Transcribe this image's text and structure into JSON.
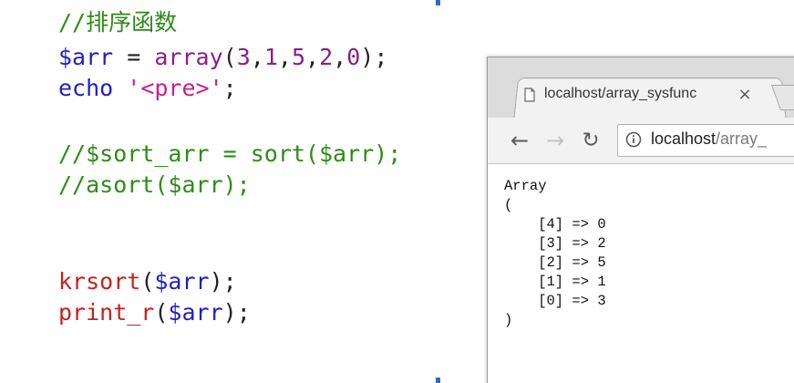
{
  "editor": {
    "lines": [
      {
        "tokens": [
          {
            "t": "//排序函数",
            "c": "tok-comment"
          }
        ]
      },
      {
        "tokens": [
          {
            "t": "$arr",
            "c": "tok-var"
          },
          {
            "t": " = ",
            "c": "tok-plain"
          },
          {
            "t": "array",
            "c": "tok-fn"
          },
          {
            "t": "(",
            "c": "tok-plain"
          },
          {
            "t": "3",
            "c": "tok-num"
          },
          {
            "t": ",",
            "c": "tok-plain"
          },
          {
            "t": "1",
            "c": "tok-num"
          },
          {
            "t": ",",
            "c": "tok-plain"
          },
          {
            "t": "5",
            "c": "tok-num"
          },
          {
            "t": ",",
            "c": "tok-plain"
          },
          {
            "t": "2",
            "c": "tok-num"
          },
          {
            "t": ",",
            "c": "tok-plain"
          },
          {
            "t": "0",
            "c": "tok-num"
          },
          {
            "t": ");",
            "c": "tok-plain"
          }
        ]
      },
      {
        "tokens": [
          {
            "t": "echo",
            "c": "tok-var"
          },
          {
            "t": " ",
            "c": "tok-plain"
          },
          {
            "t": "'<pre>'",
            "c": "tok-str"
          },
          {
            "t": ";",
            "c": "tok-plain"
          }
        ]
      },
      {
        "tokens": []
      },
      {
        "tokens": [
          {
            "t": "//$sort_arr = sort($arr);",
            "c": "tok-comment"
          }
        ]
      },
      {
        "tokens": [
          {
            "t": "//asort($arr);",
            "c": "tok-comment"
          }
        ]
      },
      {
        "tokens": []
      },
      {
        "tokens": []
      },
      {
        "tokens": [
          {
            "t": "krsort",
            "c": "tok-red"
          },
          {
            "t": "(",
            "c": "tok-plain"
          },
          {
            "t": "$arr",
            "c": "tok-var"
          },
          {
            "t": ");",
            "c": "tok-plain"
          }
        ]
      },
      {
        "tokens": [
          {
            "t": "print_r",
            "c": "tok-red"
          },
          {
            "t": "(",
            "c": "tok-plain"
          },
          {
            "t": "$arr",
            "c": "tok-var"
          },
          {
            "t": ");",
            "c": "tok-plain"
          }
        ]
      }
    ]
  },
  "browser": {
    "tab_title": "localhost/array_sysfunc",
    "tab_close": "×",
    "back_glyph": "←",
    "forward_glyph": "→",
    "reload_glyph": "↻",
    "url_host": "localhost",
    "url_path": "/array_",
    "page_output": "Array\n(\n    [4] => 0\n    [3] => 2\n    [2] => 5\n    [1] => 1\n    [0] => 3\n)"
  },
  "icons": {
    "tab": "page-icon",
    "omnibox": "info-icon",
    "back": "back-arrow-icon",
    "forward": "forward-arrow-icon",
    "reload": "reload-icon"
  },
  "colors": {
    "comment": "#2e8b17",
    "variable": "#1f1fc4",
    "function": "#8a1f8a",
    "string": "#c81f8a",
    "call": "#c81f1f"
  }
}
